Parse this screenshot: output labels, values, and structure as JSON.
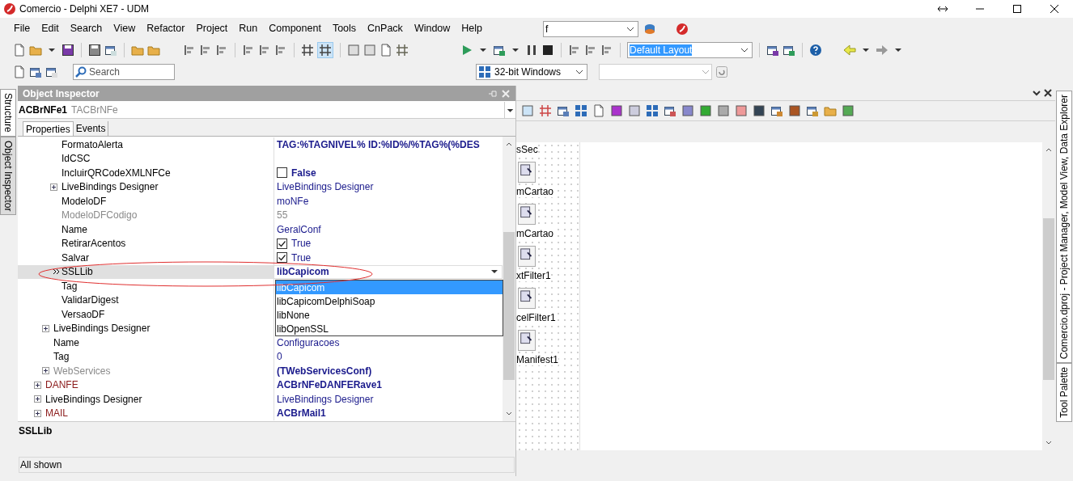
{
  "window": {
    "title": "Comercio - Delphi XE7 - UDM"
  },
  "menu": [
    "File",
    "Edit",
    "Search",
    "View",
    "Refactor",
    "Project",
    "Run",
    "Component",
    "Tools",
    "CnPack",
    "Window",
    "Help"
  ],
  "toolbar": {
    "target_field": {
      "value": "f"
    },
    "layout_field": {
      "value": "Default Layout",
      "highlighted": true
    },
    "platform_field": {
      "value": "32-bit Windows"
    },
    "search": {
      "placeholder": "Search"
    }
  },
  "side_tabs_left": [
    {
      "label": "Structure",
      "selected": true
    },
    {
      "label": "Object Inspector",
      "selected": false
    }
  ],
  "object_inspector": {
    "title": "Object Inspector",
    "component": {
      "name": "ACBrNFe1",
      "type": "TACBrNFe"
    },
    "tabs": [
      {
        "label": "Properties",
        "selected": true
      },
      {
        "label": "Events",
        "selected": false
      }
    ],
    "properties": [
      {
        "children": [
          {
            "children": [
              {
                "name": "FormatoAlerta",
                "color": "#000000",
                "value": "TAG:%TAGNIVEL% ID:%ID%/%TAG%(%DES",
                "value_bold": true,
                "value_greyed": false,
                "selected": false
              },
              {
                "name": "IdCSC",
                "color": "#000000",
                "selected": false
              },
              {
                "name": "IncluirQRCodeXMLNFCe",
                "color": "#000000",
                "kind": "checkbox",
                "checked": false,
                "value": "False",
                "value_bold": true,
                "value_greyed": false,
                "selected": false
              },
              {
                "name": "LiveBindings Designer",
                "color": "#000000",
                "expanded": false,
                "value": "LiveBindings Designer",
                "value_bold": false,
                "value_greyed": false,
                "selected": false
              },
              {
                "name": "ModeloDF",
                "color": "#000000",
                "value": "moNFe",
                "value_bold": false,
                "value_greyed": false,
                "selected": false
              },
              {
                "name": "ModeloDFCodigo",
                "color": "#8a8a8a",
                "value": "55",
                "value_bold": false,
                "value_greyed": true,
                "selected": false
              },
              {
                "name": "Name",
                "color": "#000000",
                "value": "GeralConf",
                "value_bold": false,
                "value_greyed": false,
                "selected": false
              },
              {
                "name": "RetirarAcentos",
                "color": "#000000",
                "kind": "checkbox",
                "checked": true,
                "value": "True",
                "value_bold": false,
                "value_greyed": false,
                "selected": false
              },
              {
                "name": "Salvar",
                "color": "#000000",
                "kind": "checkbox",
                "checked": true,
                "value": "True",
                "value_bold": false,
                "value_greyed": false,
                "selected": false
              },
              {
                "name": "SSLLib",
                "color": "#000000",
                "value": "libCapicom",
                "value_bold": true,
                "value_greyed": false,
                "selected": true
              },
              {
                "name": "Tag",
                "color": "#000000",
                "selected": false
              },
              {
                "name": "ValidarDigest",
                "color": "#000000",
                "selected": false
              },
              {
                "name": "VersaoDF",
                "color": "#000000",
                "selected": false
              }
            ]
          },
          {
            "name": "LiveBindings Designer",
            "color": "#000000",
            "expanded": false,
            "selected": false
          },
          {
            "name": "Name",
            "color": "#000000",
            "value": "Configuracoes",
            "value_bold": false,
            "value_greyed": false,
            "selected": false
          },
          {
            "name": "Tag",
            "color": "#000000",
            "value": "0",
            "value_bold": false,
            "value_greyed": false,
            "selected": false
          },
          {
            "name": "WebServices",
            "color": "#8a8a8a",
            "expanded": false,
            "value": "(TWebServicesConf)",
            "value_bold": true,
            "value_greyed": false,
            "selected": false
          }
        ]
      },
      {
        "name": "DANFE",
        "color": "#8b1a1a",
        "expanded": false,
        "value": "ACBrNFeDANFERave1",
        "value_bold": true,
        "value_greyed": false,
        "selected": false
      },
      {
        "name": "LiveBindings Designer",
        "color": "#000000",
        "expanded": false,
        "value": "LiveBindings Designer",
        "value_bold": false,
        "value_greyed": false,
        "selected": false
      },
      {
        "name": "MAIL",
        "color": "#8b1a1a",
        "expanded": false,
        "value": "ACBrMail1",
        "value_bold": true,
        "value_greyed": false,
        "selected": false
      }
    ],
    "dropdown": {
      "options": [
        {
          "label": "libCapicom",
          "selected": true
        },
        {
          "label": "libCapicomDelphiSoap",
          "selected": false
        },
        {
          "label": "libNone",
          "selected": false
        },
        {
          "label": "libOpenSSL",
          "selected": false
        }
      ]
    },
    "description": "SSLLib",
    "status": "All shown"
  },
  "designer": {
    "components": [
      "sSec",
      "mCartao",
      "mCartao",
      "xtFilter1",
      "celFilter1",
      "Manifest1"
    ]
  },
  "side_tabs_right": [
    {
      "label": "Comercio.dproj - Project Manager, Model View, Data Explorer"
    },
    {
      "label": "Tool Palette"
    }
  ]
}
